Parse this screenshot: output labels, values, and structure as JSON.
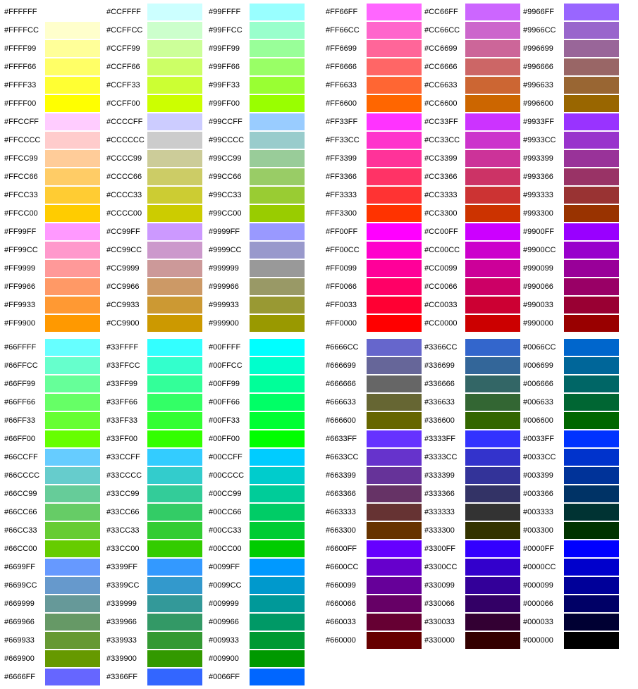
{
  "chart_data": {
    "type": "table",
    "title": "Web-safe color palette (216 colors)",
    "columns_per_block": 3,
    "rows_per_column": 17,
    "blocks": [
      {
        "side": "left",
        "columns": [
          [
            "#FFFFFF",
            "#FFFFCC",
            "#FFFF99",
            "#FFFF66",
            "#FFFF33",
            "#FFFF00",
            "#FFCCFF",
            "#FFCCCC",
            "#FFCC99",
            "#FFCC66",
            "#FFCC33",
            "#FFCC00",
            "#FF99FF",
            "#FF99CC",
            "#FF9999",
            "#FF9966",
            "#FF9933",
            "#FF9900"
          ],
          [
            "#CCFFFF",
            "#CCFFCC",
            "#CCFF99",
            "#CCFF66",
            "#CCFF33",
            "#CCFF00",
            "#CCCCFF",
            "#CCCCCC",
            "#CCCC99",
            "#CCCC66",
            "#CCCC33",
            "#CCCC00",
            "#CC99FF",
            "#CC99CC",
            "#CC9999",
            "#CC9966",
            "#CC9933",
            "#CC9900"
          ],
          [
            "#99FFFF",
            "#99FFCC",
            "#99FF99",
            "#99FF66",
            "#99FF33",
            "#99FF00",
            "#99CCFF",
            "#99CCCC",
            "#99CC99",
            "#99CC66",
            "#99CC33",
            "#99CC00",
            "#9999FF",
            "#9999CC",
            "#999999",
            "#999966",
            "#999933",
            "#999900"
          ]
        ]
      },
      {
        "side": "right",
        "columns": [
          [
            "#FF66FF",
            "#FF66CC",
            "#FF6699",
            "#FF6666",
            "#FF6633",
            "#FF6600",
            "#FF33FF",
            "#FF33CC",
            "#FF3399",
            "#FF3366",
            "#FF3333",
            "#FF3300",
            "#FF00FF",
            "#FF00CC",
            "#FF0099",
            "#FF0066",
            "#FF0033",
            "#FF0000"
          ],
          [
            "#CC66FF",
            "#CC66CC",
            "#CC6699",
            "#CC6666",
            "#CC6633",
            "#CC6600",
            "#CC33FF",
            "#CC33CC",
            "#CC3399",
            "#CC3366",
            "#CC3333",
            "#CC3300",
            "#CC00FF",
            "#CC00CC",
            "#CC0099",
            "#CC0066",
            "#CC0033",
            "#CC0000"
          ],
          [
            "#9966FF",
            "#9966CC",
            "#996699",
            "#996666",
            "#996633",
            "#996600",
            "#9933FF",
            "#9933CC",
            "#993399",
            "#993366",
            "#993333",
            "#993300",
            "#9900FF",
            "#9900CC",
            "#990099",
            "#990066",
            "#990033",
            "#990000"
          ]
        ]
      },
      {
        "side": "left",
        "columns": [
          [
            "#66FFFF",
            "#66FFCC",
            "#66FF99",
            "#66FF66",
            "#66FF33",
            "#66FF00",
            "#66CCFF",
            "#66CCCC",
            "#66CC99",
            "#66CC66",
            "#66CC33",
            "#66CC00",
            "#6699FF",
            "#6699CC",
            "#669999",
            "#669966",
            "#669933",
            "#669900",
            "#6666FF"
          ],
          [
            "#33FFFF",
            "#33FFCC",
            "#33FF99",
            "#33FF66",
            "#33FF33",
            "#33FF00",
            "#33CCFF",
            "#33CCCC",
            "#33CC99",
            "#33CC66",
            "#33CC33",
            "#33CC00",
            "#3399FF",
            "#3399CC",
            "#339999",
            "#339966",
            "#339933",
            "#339900",
            "#3366FF"
          ],
          [
            "#00FFFF",
            "#00FFCC",
            "#00FF99",
            "#00FF66",
            "#00FF33",
            "#00FF00",
            "#00CCFF",
            "#00CCCC",
            "#00CC99",
            "#00CC66",
            "#00CC33",
            "#00CC00",
            "#0099FF",
            "#0099CC",
            "#009999",
            "#009966",
            "#009933",
            "#009900",
            "#0066FF"
          ]
        ]
      },
      {
        "side": "right",
        "columns": [
          [
            "#6666CC",
            "#666699",
            "#666666",
            "#666633",
            "#666600",
            "#6633FF",
            "#6633CC",
            "#663399",
            "#663366",
            "#663333",
            "#663300",
            "#6600FF",
            "#6600CC",
            "#660099",
            "#660066",
            "#660033",
            "#660000"
          ],
          [
            "#3366CC",
            "#336699",
            "#336666",
            "#336633",
            "#336600",
            "#3333FF",
            "#3333CC",
            "#333399",
            "#333366",
            "#333333",
            "#333300",
            "#3300FF",
            "#3300CC",
            "#330099",
            "#330066",
            "#330033",
            "#330000"
          ],
          [
            "#0066CC",
            "#006699",
            "#006666",
            "#006633",
            "#006600",
            "#0033FF",
            "#0033CC",
            "#003399",
            "#003366",
            "#003333",
            "#003300",
            "#0000FF",
            "#0000CC",
            "#000099",
            "#000066",
            "#000033",
            "#000000"
          ]
        ]
      }
    ]
  }
}
